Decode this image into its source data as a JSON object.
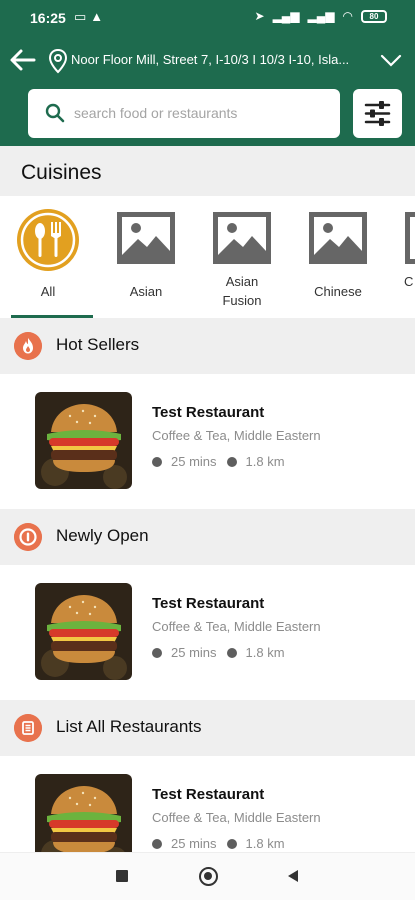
{
  "status_bar": {
    "time": "16:25",
    "left_icons": [
      "notification-icon",
      "screen-icon",
      "warning-icon"
    ],
    "right_icons": [
      "location-arrow-icon",
      "signal-icon",
      "signal-icon",
      "wifi-icon",
      "battery-icon"
    ],
    "battery_level": "80"
  },
  "header": {
    "location": "Noor Floor Mill, Street 7, I-10/3 I 10/3 I-10, Isla...",
    "icons": [
      "back-arrow-icon",
      "location-pin-icon",
      "chevron-down-icon"
    ],
    "accent_color": "#1e6b4e"
  },
  "search": {
    "placeholder": "search food or restaurants",
    "value": "",
    "filter_icon": "sliders-icon"
  },
  "cuisines": {
    "title": "Cuisines",
    "items": [
      {
        "label": "All",
        "icon": "fork-spoon-icon",
        "selected": true
      },
      {
        "label": "Asian",
        "icon": "image-placeholder-icon"
      },
      {
        "label": "Asian\nFusion",
        "icon": "image-placeholder-icon"
      },
      {
        "label": "Chinese",
        "icon": "image-placeholder-icon"
      },
      {
        "label": "C",
        "icon": "image-placeholder-icon"
      }
    ]
  },
  "sections": [
    {
      "title": "Hot Sellers",
      "icon": "flame-icon",
      "card": {
        "name": "Test Restaurant",
        "categories": "Coffee & Tea, Middle Eastern",
        "time": "25 mins",
        "distance": "1.8 km"
      }
    },
    {
      "title": "Newly Open",
      "icon": "open-badge-icon",
      "card": {
        "name": "Test Restaurant",
        "categories": "Coffee & Tea, Middle Eastern",
        "time": "25 mins",
        "distance": "1.8 km"
      }
    },
    {
      "title": "List All Restaurants",
      "icon": "list-icon",
      "card": {
        "name": "Test Restaurant",
        "categories": "Coffee & Tea, Middle Eastern",
        "time": "25 mins",
        "distance": "1.8 km"
      }
    }
  ],
  "navbar": {
    "icons": [
      "recents-square-icon",
      "home-circle-icon",
      "back-triangle-icon"
    ]
  }
}
